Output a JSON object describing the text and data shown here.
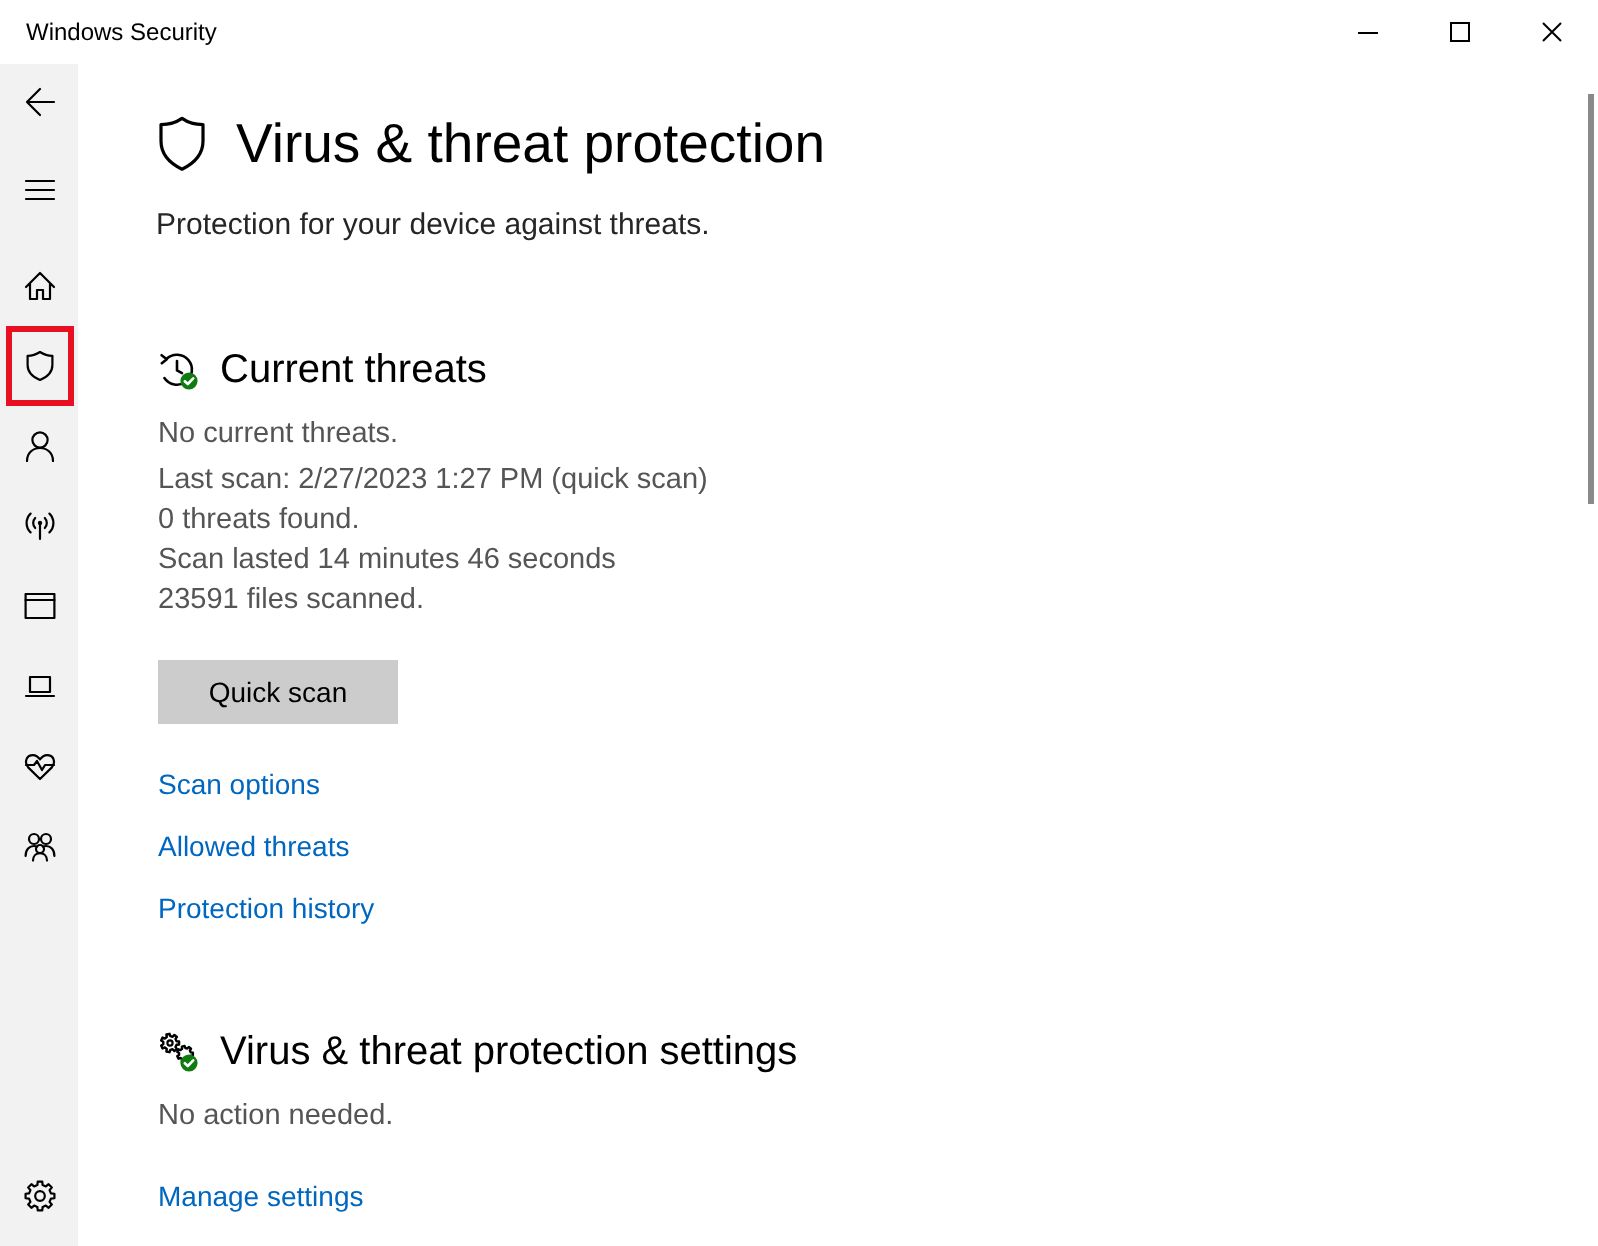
{
  "window": {
    "title": "Windows Security"
  },
  "sidebar": {
    "top_buttons": [
      {
        "kind": "back"
      },
      {
        "kind": "menu"
      }
    ],
    "items": [
      {
        "kind": "home",
        "selected": false
      },
      {
        "kind": "shield",
        "selected": true
      },
      {
        "kind": "account",
        "selected": false
      },
      {
        "kind": "network",
        "selected": false
      },
      {
        "kind": "browser",
        "selected": false
      },
      {
        "kind": "device",
        "selected": false
      },
      {
        "kind": "health",
        "selected": false
      },
      {
        "kind": "family",
        "selected": false
      }
    ],
    "footer_items": [
      {
        "kind": "settings",
        "selected": false
      }
    ]
  },
  "page": {
    "title": "Virus & threat protection",
    "subtitle": "Protection for your device against threats."
  },
  "sections": [
    {
      "kind": "history",
      "title": "Current threats",
      "summary": "No current threats.",
      "details": [
        "Last scan: 2/27/2023 1:27 PM (quick scan)",
        "0 threats found.",
        "Scan lasted 14 minutes 46 seconds",
        "23591 files scanned."
      ],
      "button": "Quick scan",
      "links": [
        "Scan options",
        "Allowed threats",
        "Protection history"
      ]
    },
    {
      "kind": "settings",
      "title": "Virus & threat protection settings",
      "summary": "No action needed.",
      "links": [
        "Manage settings"
      ]
    }
  ]
}
